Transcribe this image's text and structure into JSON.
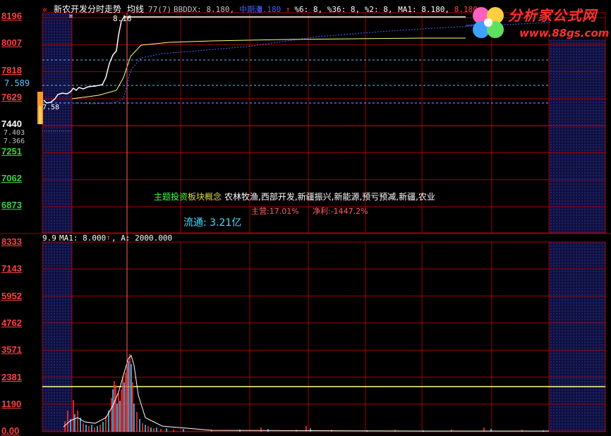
{
  "header": {
    "icon_label": "✲",
    "title": "新农开发分时走势",
    "avg_label": "均线",
    "avg_value": "77(7)",
    "indicators": [
      {
        "text": "BBDDX: 8.180,",
        "color": "#c0c0c0"
      },
      {
        "text": "中期涨",
        "color": "#4060ff"
      },
      {
        "text": "8.180",
        "color": "#4060ff"
      },
      {
        "text": "↑",
        "color": "#ff4040"
      },
      {
        "text": "%6: 8, %36: 8, %2: 8,",
        "color": "#ffffff"
      },
      {
        "text": "MA1: 8.180,",
        "color": "#ffffff"
      },
      {
        "text": "8.180,",
        "color": "#ff4040"
      }
    ]
  },
  "price_axis": {
    "labels": [
      {
        "text": "8196",
        "style": "red"
      },
      {
        "text": "8007",
        "style": "red"
      },
      {
        "text": "7818",
        "style": "red"
      },
      {
        "text": "7629",
        "style": "red"
      },
      {
        "text": "7440",
        "style": "white"
      },
      {
        "text": "7251",
        "style": "green"
      },
      {
        "text": "7062",
        "style": "green"
      },
      {
        "text": "6873",
        "style": "green"
      }
    ],
    "side_values": [
      "7.589",
      "7.403",
      "7.366"
    ]
  },
  "price_annotations": {
    "high": "8.16",
    "low": "7.58"
  },
  "info": {
    "theme_label": "主题投资",
    "theme_overlap": "板块概念",
    "concepts": "农林牧渔,西部开发,新疆振兴,新能源,预亏预减,新疆,农业",
    "main_business": "主营:17.01%",
    "net_profit": "净利:-1447.2%",
    "float_shares": "流通: 3.21亿"
  },
  "volume_header": {
    "value": "9.9",
    "ma_text": "MA1: 8.000",
    "arrow": "↑",
    "a_text": ", A: 2000.000"
  },
  "volume_axis": {
    "labels": [
      "8333",
      "7143",
      "5952",
      "4762",
      "3571",
      "2381",
      "1190",
      "0.00"
    ]
  },
  "logo": {
    "name": "分析家公式网",
    "url": "www.88gs.com"
  },
  "colors": {
    "grid": "#a00000",
    "price_line": "#ffffff",
    "avg_line": "#ffff80",
    "dash_blue": "#5060ff",
    "dash_cyan": "#60c0ff",
    "volume_up": "#ff3030",
    "volume_down": "#40c0ff",
    "threshold": "#ffff80"
  },
  "chart_data": {
    "type": "line",
    "price_range": [
      6873,
      8196
    ],
    "prev_close": 7440,
    "price_series": [
      7580,
      7590,
      7600,
      7620,
      7650,
      7640,
      7680,
      7700,
      7720,
      7710,
      7750,
      7760,
      7780,
      7900,
      8050,
      8120,
      8160,
      8180,
      8180
    ],
    "avg_series": [
      7580,
      7590,
      7600,
      7610,
      7620,
      7630,
      7650,
      7680,
      7720,
      7760,
      7790,
      7820,
      7840,
      7860,
      7880,
      7900,
      7920,
      7940,
      7950
    ],
    "volume_range": [
      0,
      8333
    ],
    "volume_threshold": 2000
  }
}
